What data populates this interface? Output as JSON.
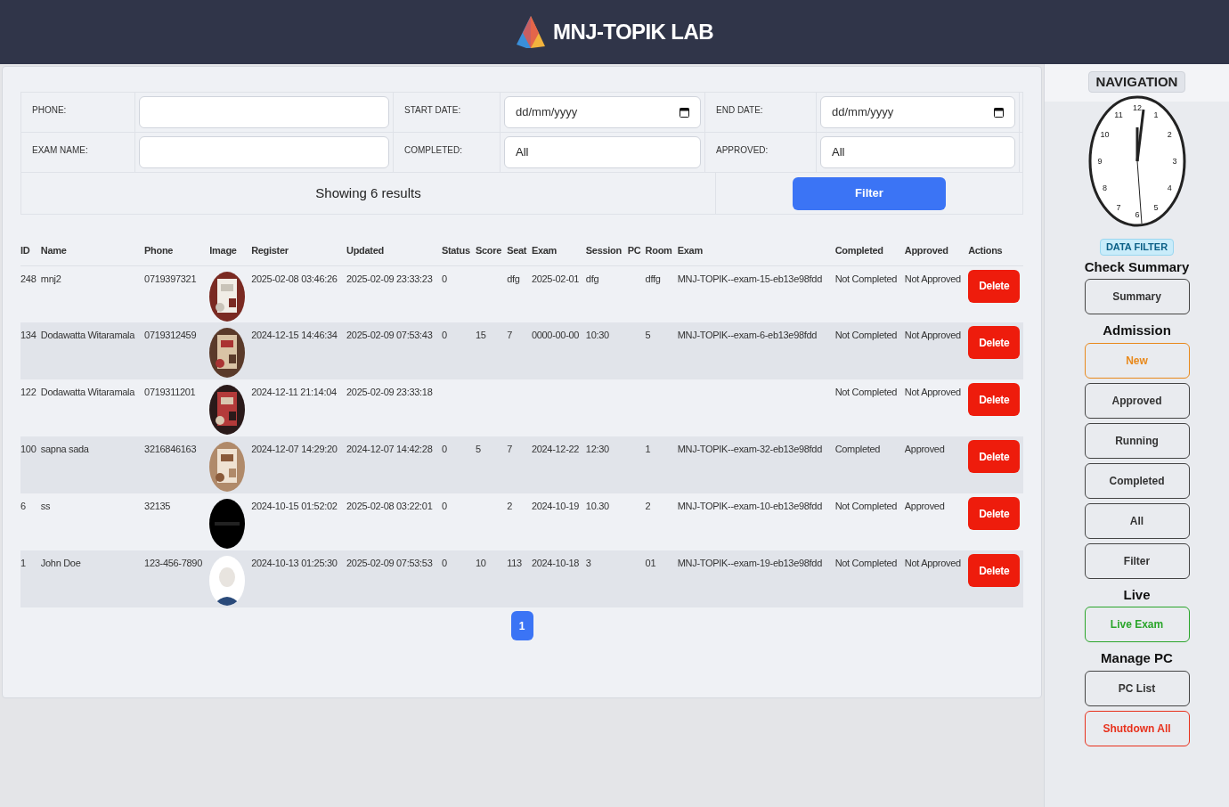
{
  "header": {
    "title": "MNJ-TOPIK LAB"
  },
  "filters": {
    "fields": [
      {
        "label": "PHONE:",
        "kind": "text"
      },
      {
        "label": "START DATE:",
        "kind": "date",
        "placeholder": "dd/mm/yyyy"
      },
      {
        "label": "END DATE:",
        "kind": "date",
        "placeholder": "dd/mm/yyyy"
      },
      {
        "label": "EXAM NAME:",
        "kind": "text"
      },
      {
        "label": "COMPLETED:",
        "kind": "select",
        "value": "All"
      },
      {
        "label": "APPROVED:",
        "kind": "select",
        "value": "All"
      }
    ],
    "results": "Showing 6 results",
    "button": "Filter"
  },
  "table": {
    "columns": [
      "ID",
      "Name",
      "Phone",
      "Image",
      "Register",
      "Updated",
      "Status",
      "Score",
      "Seat",
      "Exam",
      "Session",
      "PC",
      "Room",
      "Exam",
      "Completed",
      "Approved",
      "Actions"
    ],
    "rows": [
      {
        "cells": [
          "248",
          "mnj2",
          "0719397321",
          null,
          "2025-02-08 03:46:26",
          "2025-02-09 23:33:23",
          "0",
          null,
          "dfg",
          "2025-02-01",
          "dfg",
          null,
          "dffg",
          "MNJ-TOPIK--exam-15-eb13e98fdd",
          "Not Completed",
          "Not Approved"
        ],
        "image": {
          "kind": "picture"
        },
        "action": "Delete"
      },
      {
        "cells": [
          "134",
          "Dodawatta Witaramala",
          "0719312459",
          null,
          "2024-12-15 14:46:34",
          "2025-02-09 07:53:43",
          "0",
          "15",
          "7",
          "0000-00-00",
          "10:30",
          null,
          "5",
          "MNJ-TOPIK--exam-6-eb13e98fdd",
          "Not Completed",
          "Not Approved"
        ],
        "image": {
          "kind": "picture"
        },
        "action": "Delete"
      },
      {
        "cells": [
          "122",
          "Dodawatta Witaramala",
          "0719311201",
          null,
          "2024-12-11 21:14:04",
          "2025-02-09 23:33:18",
          null,
          null,
          null,
          null,
          null,
          null,
          null,
          null,
          "Not Completed",
          "Not Approved"
        ],
        "image": {
          "kind": "picture"
        },
        "action": "Delete"
      },
      {
        "cells": [
          "100",
          "sapna sada",
          "3216846163",
          null,
          "2024-12-07 14:29:20",
          "2024-12-07 14:42:28",
          "0",
          "5",
          "7",
          "2024-12-22",
          "12:30",
          null,
          "1",
          "MNJ-TOPIK--exam-32-eb13e98fdd",
          "Completed",
          "Approved"
        ],
        "image": {
          "kind": "picture"
        },
        "action": "Delete"
      },
      {
        "cells": [
          "6",
          "ss",
          "32135",
          null,
          "2024-10-15 01:52:02",
          "2025-02-08 03:22:01",
          "0",
          null,
          "2",
          "2024-10-19",
          "10.30",
          null,
          "2",
          "MNJ-TOPIK--exam-10-eb13e98fdd",
          "Not Completed",
          "Approved"
        ],
        "image": {
          "kind": "picture"
        },
        "action": "Delete"
      },
      {
        "cells": [
          "1",
          "John Doe",
          "123-456-7890",
          null,
          "2024-10-13 01:25:30",
          "2025-02-09 07:53:53",
          "0",
          "10",
          "113",
          "2024-10-18",
          "3",
          null,
          "01",
          "MNJ-TOPIK--exam-19-eb13e98fdd",
          "Not Completed",
          "Not Approved"
        ],
        "image": {
          "kind": "picture"
        },
        "action": "Delete"
      }
    ]
  },
  "pagination": [
    {
      "label": "1",
      "selected": true
    }
  ],
  "sidebar": {
    "title": "NAVIGATION",
    "clock": {
      "numerals": [
        "12",
        "1",
        "2",
        "3",
        "4",
        "5",
        "6",
        "7",
        "8",
        "9",
        "10",
        "11"
      ]
    },
    "badge": "DATA FILTER",
    "items": [
      {
        "kind": "heading",
        "label": "Check Summary"
      },
      {
        "kind": "button",
        "label": "Summary"
      },
      {
        "kind": "heading",
        "label": "Admission"
      },
      {
        "kind": "button",
        "label": "New",
        "color": "#e8891c"
      },
      {
        "kind": "button",
        "label": "Approved"
      },
      {
        "kind": "button",
        "label": "Running"
      },
      {
        "kind": "button",
        "label": "Completed"
      },
      {
        "kind": "button",
        "label": "All"
      },
      {
        "kind": "button",
        "label": "Filter"
      },
      {
        "kind": "heading",
        "label": "Live"
      },
      {
        "kind": "button",
        "label": "Live Exam",
        "color": "#2aa52a"
      },
      {
        "kind": "heading",
        "label": "Manage PC"
      },
      {
        "kind": "button",
        "label": "PC List"
      },
      {
        "kind": "button",
        "label": "Shutdown All",
        "color": "#e8311c"
      }
    ]
  }
}
